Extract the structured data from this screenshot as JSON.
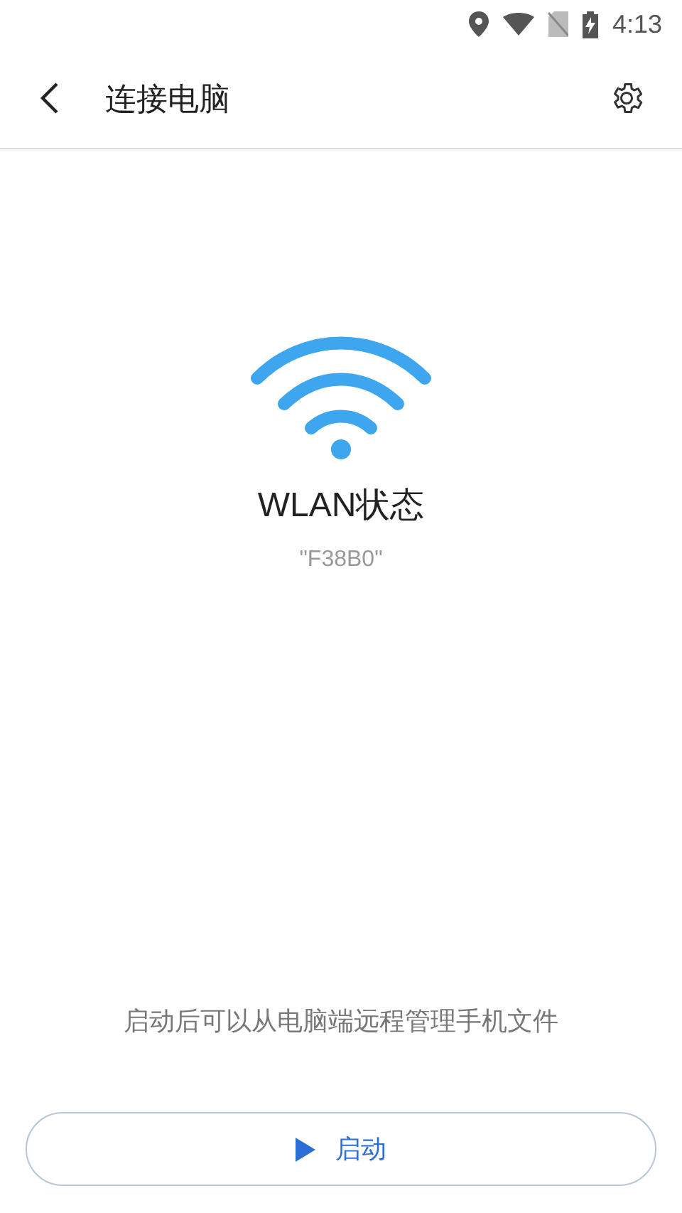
{
  "status_bar": {
    "time": "4:13"
  },
  "header": {
    "title": "连接电脑"
  },
  "status": {
    "title": "WLAN状态",
    "network": "\"F38B0\""
  },
  "hint": "启动后可以从电脑端远程管理手机文件",
  "start_button": {
    "label": "启动"
  }
}
